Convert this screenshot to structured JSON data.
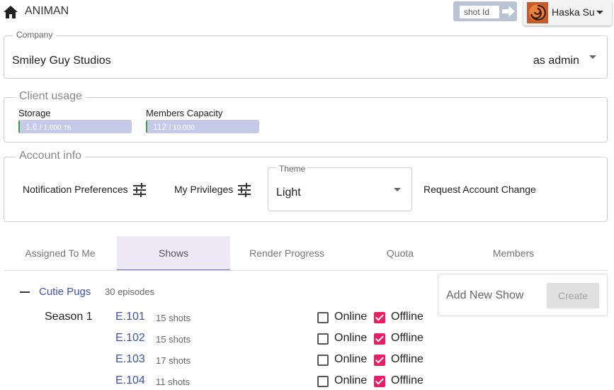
{
  "header": {
    "app_title": "ANIMAN",
    "home_icon": "home-icon",
    "shot_search_placeholder": "shot Id",
    "shot_go_icon": "arrow-right-icon",
    "user_name": "Haska Su"
  },
  "company": {
    "legend": "Company",
    "name": "Smiley Guy Studios",
    "role": "as admin"
  },
  "client_usage": {
    "legend": "Client usage",
    "storage": {
      "label": "Storage",
      "value": "1.6",
      "of": "/ 1,000",
      "unit": "TB",
      "fraction": 0.0016
    },
    "members": {
      "label": "Members Capacity",
      "value": "112",
      "of": "/ 10,000",
      "fraction": 0.0112
    }
  },
  "account_info": {
    "legend": "Account info",
    "notification_label": "Notification Preferences",
    "privileges_label": "My Privileges",
    "theme_legend": "Theme",
    "theme_value": "Light",
    "request_label": "Request Account Change"
  },
  "tabs": [
    {
      "label": "Assigned To Me"
    },
    {
      "label": "Shows",
      "active": true
    },
    {
      "label": "Render Progress"
    },
    {
      "label": "Quota"
    },
    {
      "label": "Members"
    }
  ],
  "shows": {
    "show_name": "Cutie Pugs",
    "episode_count": "30 episodes",
    "season_label": "Season 1",
    "online_label": "Online",
    "offline_label": "Offline",
    "episodes": [
      {
        "code": "E.101",
        "shots": "15 shots",
        "online": false,
        "offline": true
      },
      {
        "code": "E.102",
        "shots": "15 shots",
        "online": false,
        "offline": true
      },
      {
        "code": "E.103",
        "shots": "17 shots",
        "online": false,
        "offline": true
      },
      {
        "code": "E.104",
        "shots": "11 shots",
        "online": false,
        "offline": true
      }
    ]
  },
  "add_show": {
    "placeholder": "Add New Show",
    "create_label": "Create"
  },
  "colors": {
    "accent": "#3f51b5",
    "checkbox_checked": "#e91e63",
    "usage_bar": "#c5cae9",
    "usage_fill": "#3f9a49",
    "tab_active_bg": "#ede7f6"
  }
}
